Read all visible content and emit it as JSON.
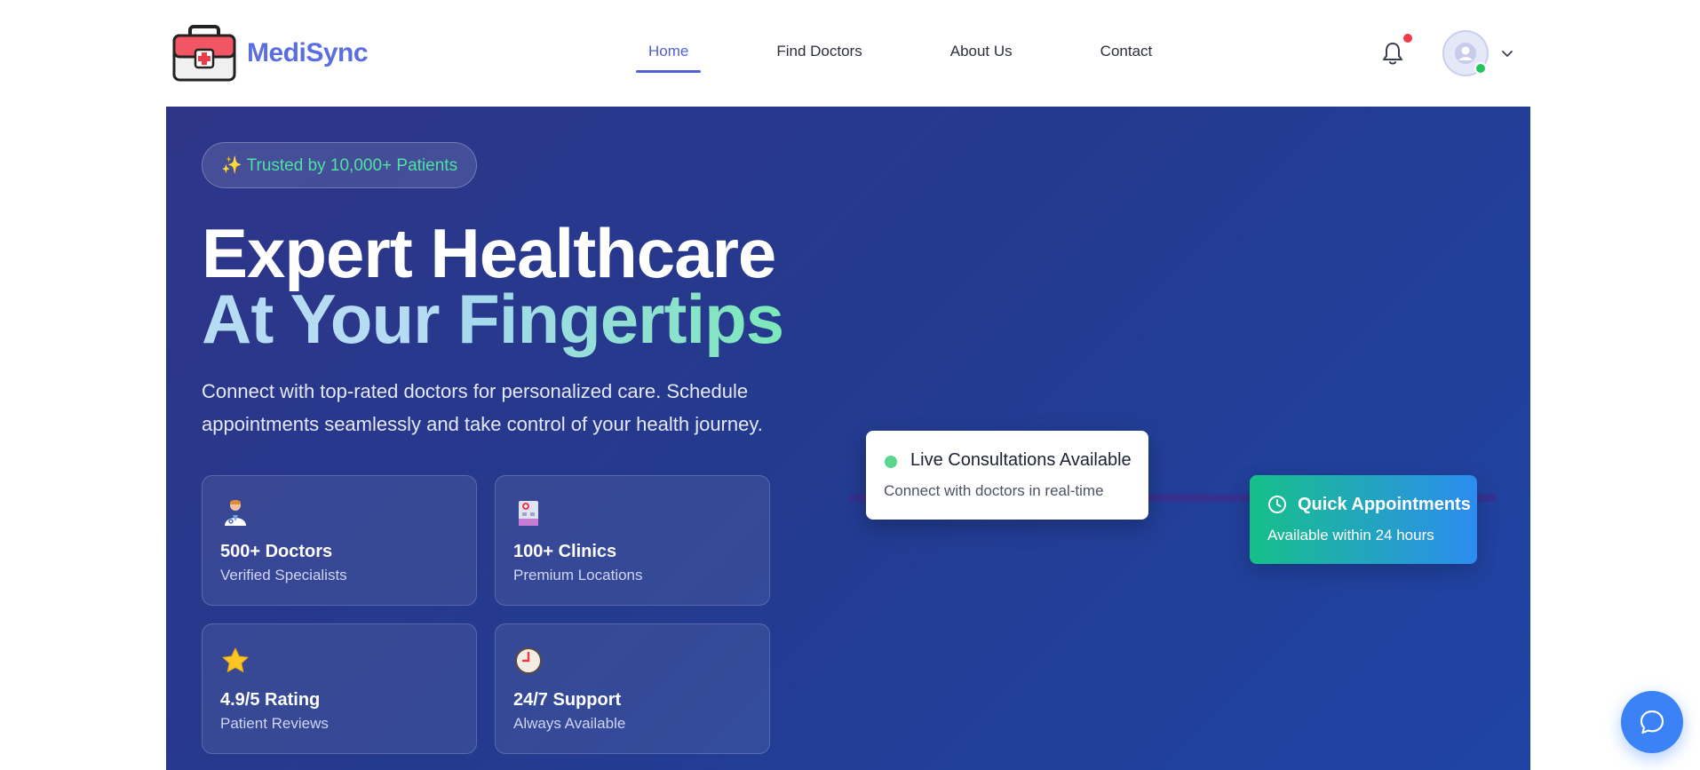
{
  "brand": {
    "name": "MediSync",
    "icon": "medical-kit-icon"
  },
  "nav": {
    "items": [
      {
        "label": "Home",
        "active": true
      },
      {
        "label": "Find Doctors",
        "active": false
      },
      {
        "label": "About Us",
        "active": false
      },
      {
        "label": "Contact",
        "active": false
      }
    ]
  },
  "header_actions": {
    "notifications_icon": "bell-icon",
    "avatar_icon": "user-icon",
    "menu_icon": "chevron-down-icon"
  },
  "hero": {
    "badge": "✨ Trusted by 10,000+ Patients",
    "headline_line1": "Expert Healthcare",
    "headline_line2_a": "At Your ",
    "headline_line2_b": "Fingertips",
    "lead": "Connect with top-rated doctors for personalized care. Schedule appointments seamlessly and take control of your health journey.",
    "stats": [
      {
        "icon": "doctor-icon",
        "title": "500+ Doctors",
        "subtitle": "Verified Specialists"
      },
      {
        "icon": "clinic-icon",
        "title": "100+ Clinics",
        "subtitle": "Premium Locations"
      },
      {
        "icon": "star-icon",
        "title": "4.9/5 Rating",
        "subtitle": "Patient Reviews"
      },
      {
        "icon": "clock-icon",
        "title": "24/7 Support",
        "subtitle": "Always Available"
      }
    ],
    "live_card": {
      "title": "Live Consultations Available",
      "subtitle": "Connect with doctors in real-time"
    },
    "quick_card": {
      "icon": "clock-icon",
      "title": "Quick Appointments",
      "subtitle": "Available within 24 hours"
    }
  },
  "chat": {
    "icon": "chat-bubble-icon"
  },
  "colors": {
    "brand": "#5b6ee1",
    "accent_green": "#4ee2a0",
    "hero_bg": "#243a8e",
    "chat_button": "#3b82f6"
  }
}
